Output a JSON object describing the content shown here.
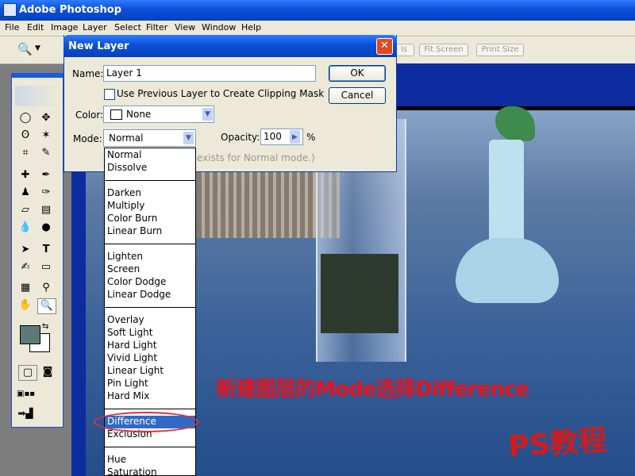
{
  "app": {
    "title": "Adobe Photoshop"
  },
  "menu": [
    "File",
    "Edit",
    "Image",
    "Layer",
    "Select",
    "Filter",
    "View",
    "Window",
    "Help"
  ],
  "options_bar": {
    "buttons": [
      "ls",
      "Fit Screen",
      "Print Size"
    ]
  },
  "dialog": {
    "title": "New Layer",
    "name_label": "Name:",
    "name_value": "Layer 1",
    "clip_checkbox_label": "Use Previous Layer to Create Clipping Mask",
    "color_label": "Color:",
    "color_value": "None",
    "mode_label": "Mode:",
    "mode_value": "Normal",
    "opacity_label": "Opacity:",
    "opacity_value": "100",
    "opacity_unit": "%",
    "hint_text": "exists for Normal mode.)",
    "ok_label": "OK",
    "cancel_label": "Cancel"
  },
  "mode_options": [
    "Normal",
    "Dissolve",
    "Darken",
    "Multiply",
    "Color Burn",
    "Linear Burn",
    "Lighten",
    "Screen",
    "Color Dodge",
    "Linear Dodge",
    "Overlay",
    "Soft Light",
    "Hard Light",
    "Vivid Light",
    "Linear Light",
    "Pin Light",
    "Hard Mix",
    "Difference",
    "Exclusion",
    "Hue",
    "Saturation"
  ],
  "selected_mode": "Difference",
  "annotation": {
    "caption": "新建图层的Mode选择Difference",
    "watermark": "PS教程"
  },
  "colors": {
    "accent": "#316ac5",
    "caption": "#e8121c",
    "titlebar": "#0b50d8"
  }
}
